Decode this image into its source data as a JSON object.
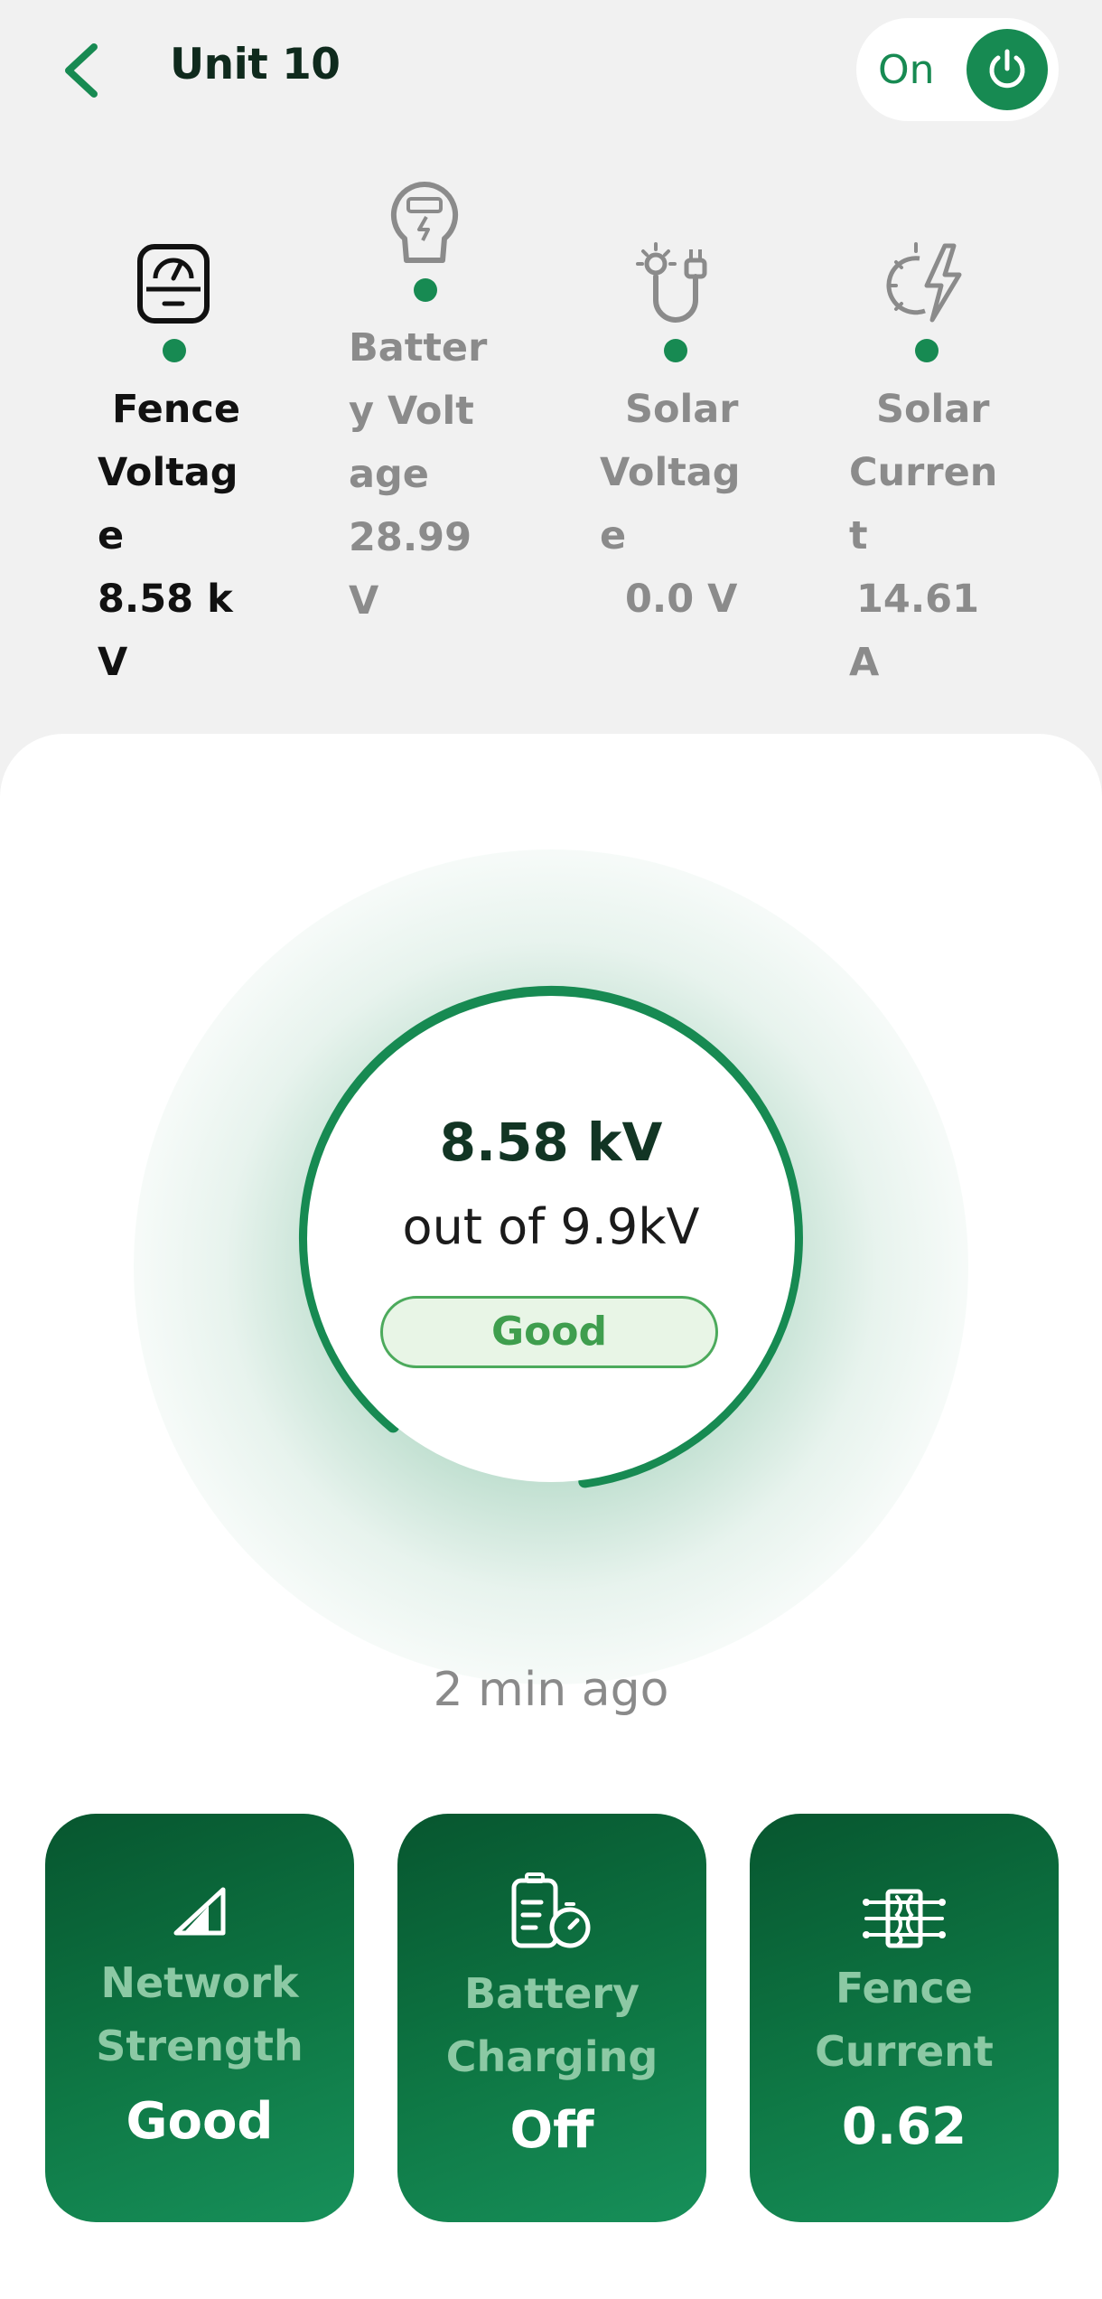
{
  "header": {
    "title": "Unit 10",
    "back_icon": "chevron-left-icon",
    "power_toggle": {
      "label": "On",
      "state": "on",
      "icon": "power-icon"
    }
  },
  "metrics": [
    {
      "label": "Fence Voltage",
      "value": "8.58 kV",
      "icon": "voltmeter-icon",
      "active": true
    },
    {
      "label": "Battery Voltage",
      "value": "28.99 V",
      "icon": "battery-meter-icon",
      "active": false
    },
    {
      "label": "Solar Voltage",
      "value": "0.0 V",
      "icon": "solar-plug-icon",
      "active": false
    },
    {
      "label": "Solar Current",
      "value": "14.61 A",
      "icon": "solar-lightning-icon",
      "active": false
    }
  ],
  "gauge": {
    "value": "8.58 kV",
    "max_text": "out of 9.9kV",
    "status": "Good",
    "level": 0.867
  },
  "last_updated": "2 min ago",
  "tiles": [
    {
      "label": "Network Strength",
      "value": "Good",
      "icon": "signal-icon"
    },
    {
      "label": "Battery Charging",
      "value": "Off",
      "icon": "battery-timer-icon"
    },
    {
      "label": "Fence Current",
      "value": "0.62",
      "icon": "fence-circuit-icon"
    }
  ],
  "colors": {
    "accent": "#178a52",
    "badge_green": "#4caa5c",
    "tile_dark": "#07562f",
    "tile_light": "#17905a"
  }
}
